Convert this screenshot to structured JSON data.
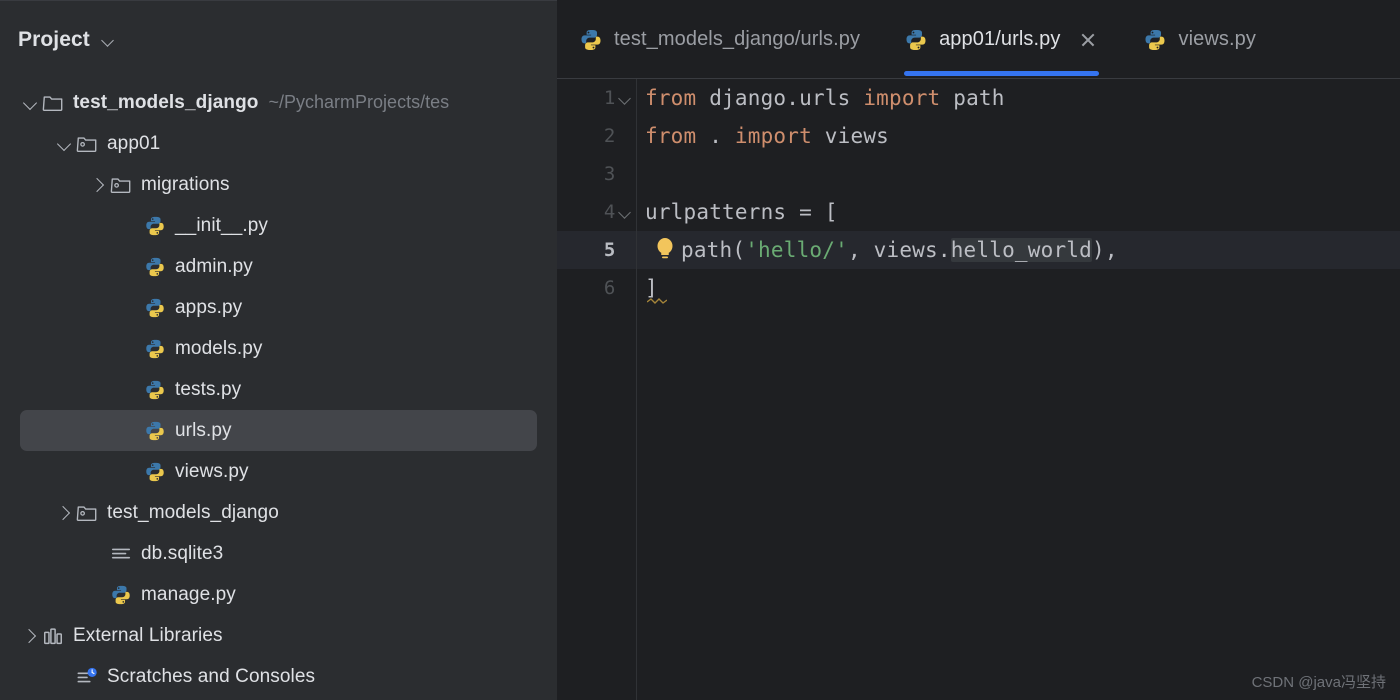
{
  "sidebar": {
    "panel_title": "Project",
    "panel_chevron": "chevron-down-icon",
    "tree": [
      {
        "label": "test_models_django",
        "path": "~/PycharmProjects/tes",
        "icon": "folder-icon",
        "twisty": "open",
        "indent": 0,
        "bold": true,
        "selected": false
      },
      {
        "label": "app01",
        "path": "",
        "icon": "source-folder-icon",
        "twisty": "open",
        "indent": 1,
        "bold": false,
        "selected": false
      },
      {
        "label": "migrations",
        "path": "",
        "icon": "source-folder-icon",
        "twisty": "closed",
        "indent": 2,
        "bold": false,
        "selected": false
      },
      {
        "label": "__init__.py",
        "path": "",
        "icon": "python-file-icon",
        "twisty": "none",
        "indent": 3,
        "bold": false,
        "selected": false
      },
      {
        "label": "admin.py",
        "path": "",
        "icon": "python-file-icon",
        "twisty": "none",
        "indent": 3,
        "bold": false,
        "selected": false
      },
      {
        "label": "apps.py",
        "path": "",
        "icon": "python-file-icon",
        "twisty": "none",
        "indent": 3,
        "bold": false,
        "selected": false
      },
      {
        "label": "models.py",
        "path": "",
        "icon": "python-file-icon",
        "twisty": "none",
        "indent": 3,
        "bold": false,
        "selected": false
      },
      {
        "label": "tests.py",
        "path": "",
        "icon": "python-file-icon",
        "twisty": "none",
        "indent": 3,
        "bold": false,
        "selected": false
      },
      {
        "label": "urls.py",
        "path": "",
        "icon": "python-file-icon",
        "twisty": "none",
        "indent": 3,
        "bold": false,
        "selected": true
      },
      {
        "label": "views.py",
        "path": "",
        "icon": "python-file-icon",
        "twisty": "none",
        "indent": 3,
        "bold": false,
        "selected": false
      },
      {
        "label": "test_models_django",
        "path": "",
        "icon": "source-folder-icon",
        "twisty": "closed",
        "indent": 1,
        "bold": false,
        "selected": false
      },
      {
        "label": "db.sqlite3",
        "path": "",
        "icon": "database-file-icon",
        "twisty": "none",
        "indent": 2,
        "bold": false,
        "selected": false
      },
      {
        "label": "manage.py",
        "path": "",
        "icon": "python-file-icon",
        "twisty": "none",
        "indent": 2,
        "bold": false,
        "selected": false
      },
      {
        "label": "External Libraries",
        "path": "",
        "icon": "library-icon",
        "twisty": "closed",
        "indent": 0,
        "bold": false,
        "selected": false
      },
      {
        "label": "Scratches and Consoles",
        "path": "",
        "icon": "scratches-icon",
        "twisty": "none",
        "indent": 1,
        "bold": false,
        "selected": false
      }
    ]
  },
  "editor": {
    "tabs": [
      {
        "label": "test_models_django/urls.py",
        "icon": "python-file-icon",
        "active": false,
        "closable": false
      },
      {
        "label": "app01/urls.py",
        "icon": "python-file-icon",
        "active": true,
        "closable": true
      },
      {
        "label": "views.py",
        "icon": "python-file-icon",
        "active": false,
        "closable": false
      }
    ],
    "active_tab_indicator_color": "#3574f0",
    "close_icon": "close-icon",
    "lines": [
      {
        "number": "1",
        "fold": true,
        "current": false,
        "bulb": false,
        "squiggle": false
      },
      {
        "number": "2",
        "fold": false,
        "current": false,
        "bulb": false,
        "squiggle": false
      },
      {
        "number": "3",
        "fold": false,
        "current": false,
        "bulb": false,
        "squiggle": false
      },
      {
        "number": "4",
        "fold": true,
        "current": false,
        "bulb": false,
        "squiggle": false
      },
      {
        "number": "5",
        "fold": false,
        "current": true,
        "bulb": true,
        "squiggle": false
      },
      {
        "number": "6",
        "fold": false,
        "current": false,
        "bulb": false,
        "squiggle": true
      }
    ],
    "code": {
      "l1_kw_from": "from",
      "l1_module": " django.urls ",
      "l1_kw_import": "import",
      "l1_name": " path",
      "l2_kw_from": "from",
      "l2_dot": " . ",
      "l2_kw_import": "import",
      "l2_name": " views",
      "l3": "",
      "l4": "urlpatterns = [",
      "l5_call": "path(",
      "l5_string": "'hello/'",
      "l5_mid": ", views.",
      "l5_highlight": "hello_world",
      "l5_end": "),",
      "l6": "]"
    },
    "bulb_icon": "lightbulb-icon",
    "watermark": "CSDN @java冯坚持"
  },
  "colors": {
    "sidebar_bg": "#2b2d30",
    "editor_bg": "#1e1f22",
    "selection_bg": "#43454a",
    "current_line_bg": "#26282e",
    "accent_blue": "#3574f0",
    "keyword_orange": "#cf8e6d",
    "string_green": "#6aab73",
    "text_gray": "#bcbec4"
  }
}
